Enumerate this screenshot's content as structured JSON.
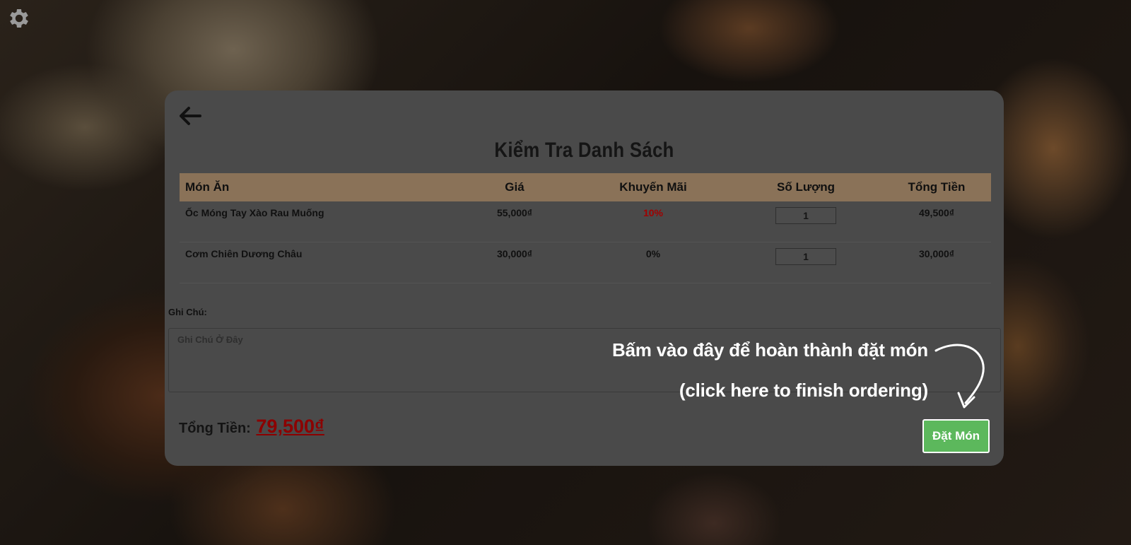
{
  "modal": {
    "title": "Kiểm Tra Danh Sách",
    "table": {
      "headers": [
        "Món Ăn",
        "Giá",
        "Khuyến Mãi",
        "Số Lượng",
        "Tổng Tiền"
      ],
      "rows": [
        {
          "dish": "Ốc Móng Tay Xào Rau Muống",
          "price": "55,000₫",
          "promo": "10%",
          "quantity": "1",
          "total": "49,500₫"
        },
        {
          "dish": "Cơm Chiên Dương Châu",
          "price": "30,000₫",
          "promo": "0%",
          "quantity": "1",
          "total": "30,000₫"
        }
      ]
    },
    "note": {
      "label": "Ghi Chú:",
      "placeholder": "Ghi Chú Ở Đây",
      "value": ""
    },
    "total": {
      "label": "Tổng Tiền:",
      "value": "79,500₫"
    },
    "order_button_label": "Đặt Món"
  },
  "hint": {
    "vi": "Bấm vào đây để hoàn thành đặt món",
    "en": "(click here to finish ordering)"
  },
  "icons": {
    "settings": "gear-icon",
    "back": "arrow-left-icon",
    "hint_arrow": "curved-arrow-icon"
  },
  "colors": {
    "accent_green": "#5cb85c",
    "promo_red": "#a00000",
    "header_bg": "#8a7258"
  }
}
